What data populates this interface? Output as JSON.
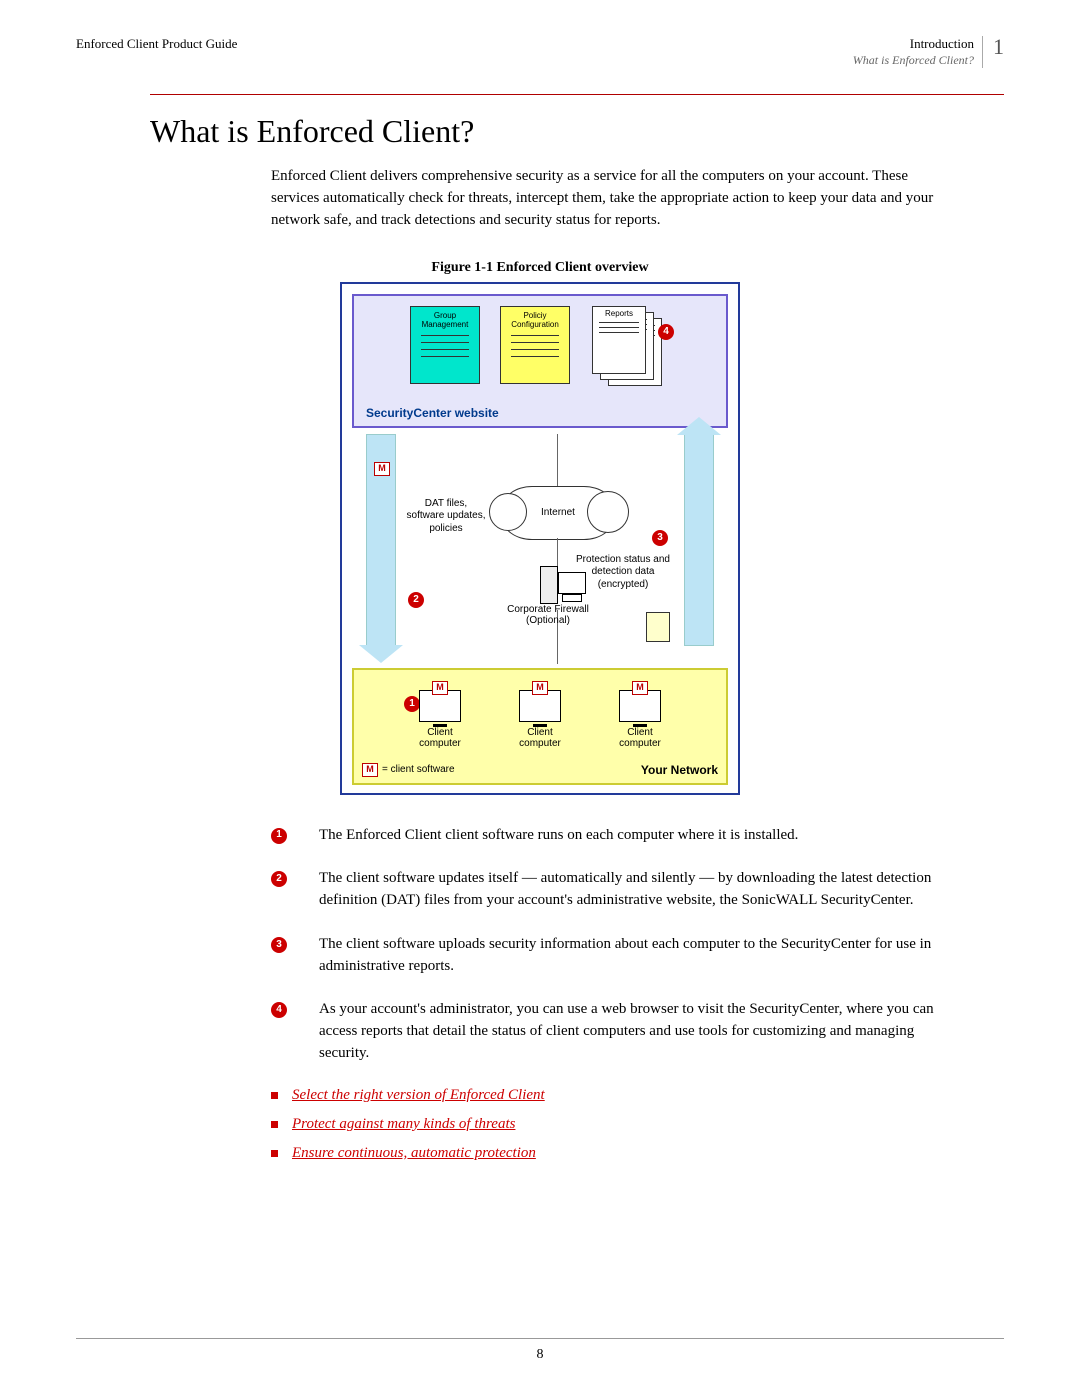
{
  "header": {
    "left": "Enforced Client Product Guide",
    "section": "Introduction",
    "subtitle": "What is Enforced Client?",
    "chapter_number": "1"
  },
  "title": "What is Enforced Client?",
  "intro": "Enforced Client delivers comprehensive security as a service for all the computers on your account. These services automatically check for threats, intercept them, take the appropriate action to keep your data and your network safe, and track detections and security status for reports.",
  "figure": {
    "caption": "Figure 1-1  Enforced Client overview",
    "cards": {
      "group": "Group Management",
      "policy": "Policiy Configuration",
      "reports": "Reports"
    },
    "sc_title": "SecurityCenter website",
    "dat_label": "DAT files, software updates, policies",
    "internet": "Internet",
    "firewall": "Corporate Firewall (Optional)",
    "protection": "Protection status and detection data (encrypted)",
    "client_label": "Client computer",
    "legend_left": " = client software",
    "your_network": "Your Network",
    "m": "M"
  },
  "numbered": [
    "The Enforced Client client software runs on each computer where it is installed.",
    "The client software updates itself — automatically and silently — by downloading the latest detection definition (DAT) files from your account's administrative website, the SonicWALL SecurityCenter.",
    "The client software uploads security information about each computer to the SecurityCenter for use in administrative reports.",
    "As your account's administrator, you can use a web browser to visit the SecurityCenter, where you can access reports that detail the status of client computers and use tools for customizing and managing security."
  ],
  "links": [
    "Select the right version of Enforced Client",
    "Protect against many kinds of threats",
    "Ensure continuous, automatic protection"
  ],
  "footer_page": "8"
}
